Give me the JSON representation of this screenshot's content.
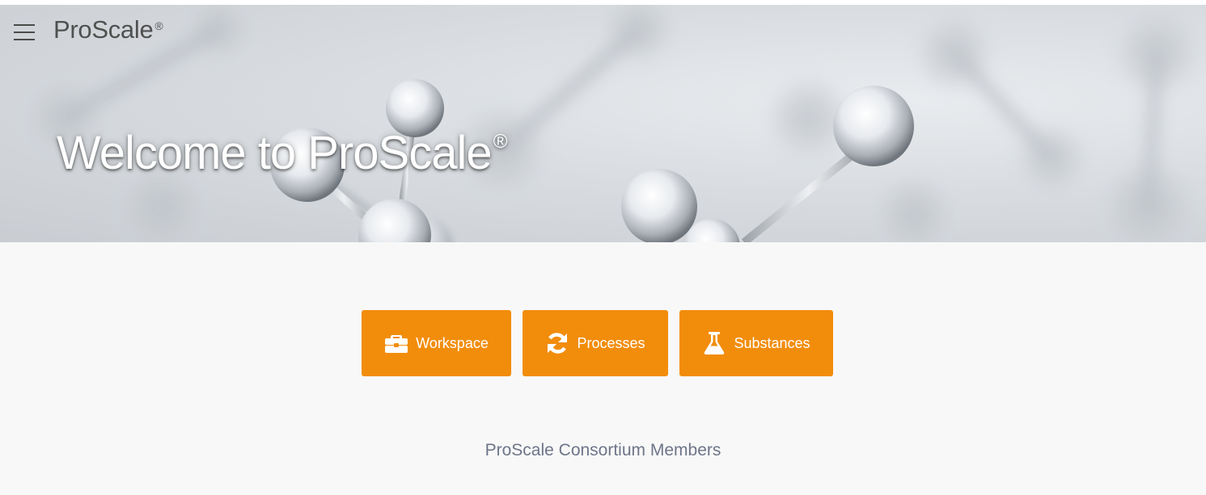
{
  "header": {
    "brand_name": "ProScale",
    "brand_mark": "®",
    "menu_icon": "hamburger-menu-icon"
  },
  "hero": {
    "title": "Welcome to ProScale",
    "title_mark": "®"
  },
  "nav": {
    "buttons": [
      {
        "label": "Workspace",
        "icon": "briefcase-icon"
      },
      {
        "label": "Processes",
        "icon": "refresh-icon"
      },
      {
        "label": "Substances",
        "icon": "flask-icon"
      }
    ]
  },
  "footer": {
    "members_label": "ProScale Consortium Members"
  },
  "colors": {
    "accent": "#f28d0c",
    "background": "#f8f8f8",
    "members_text": "#6e7589"
  }
}
